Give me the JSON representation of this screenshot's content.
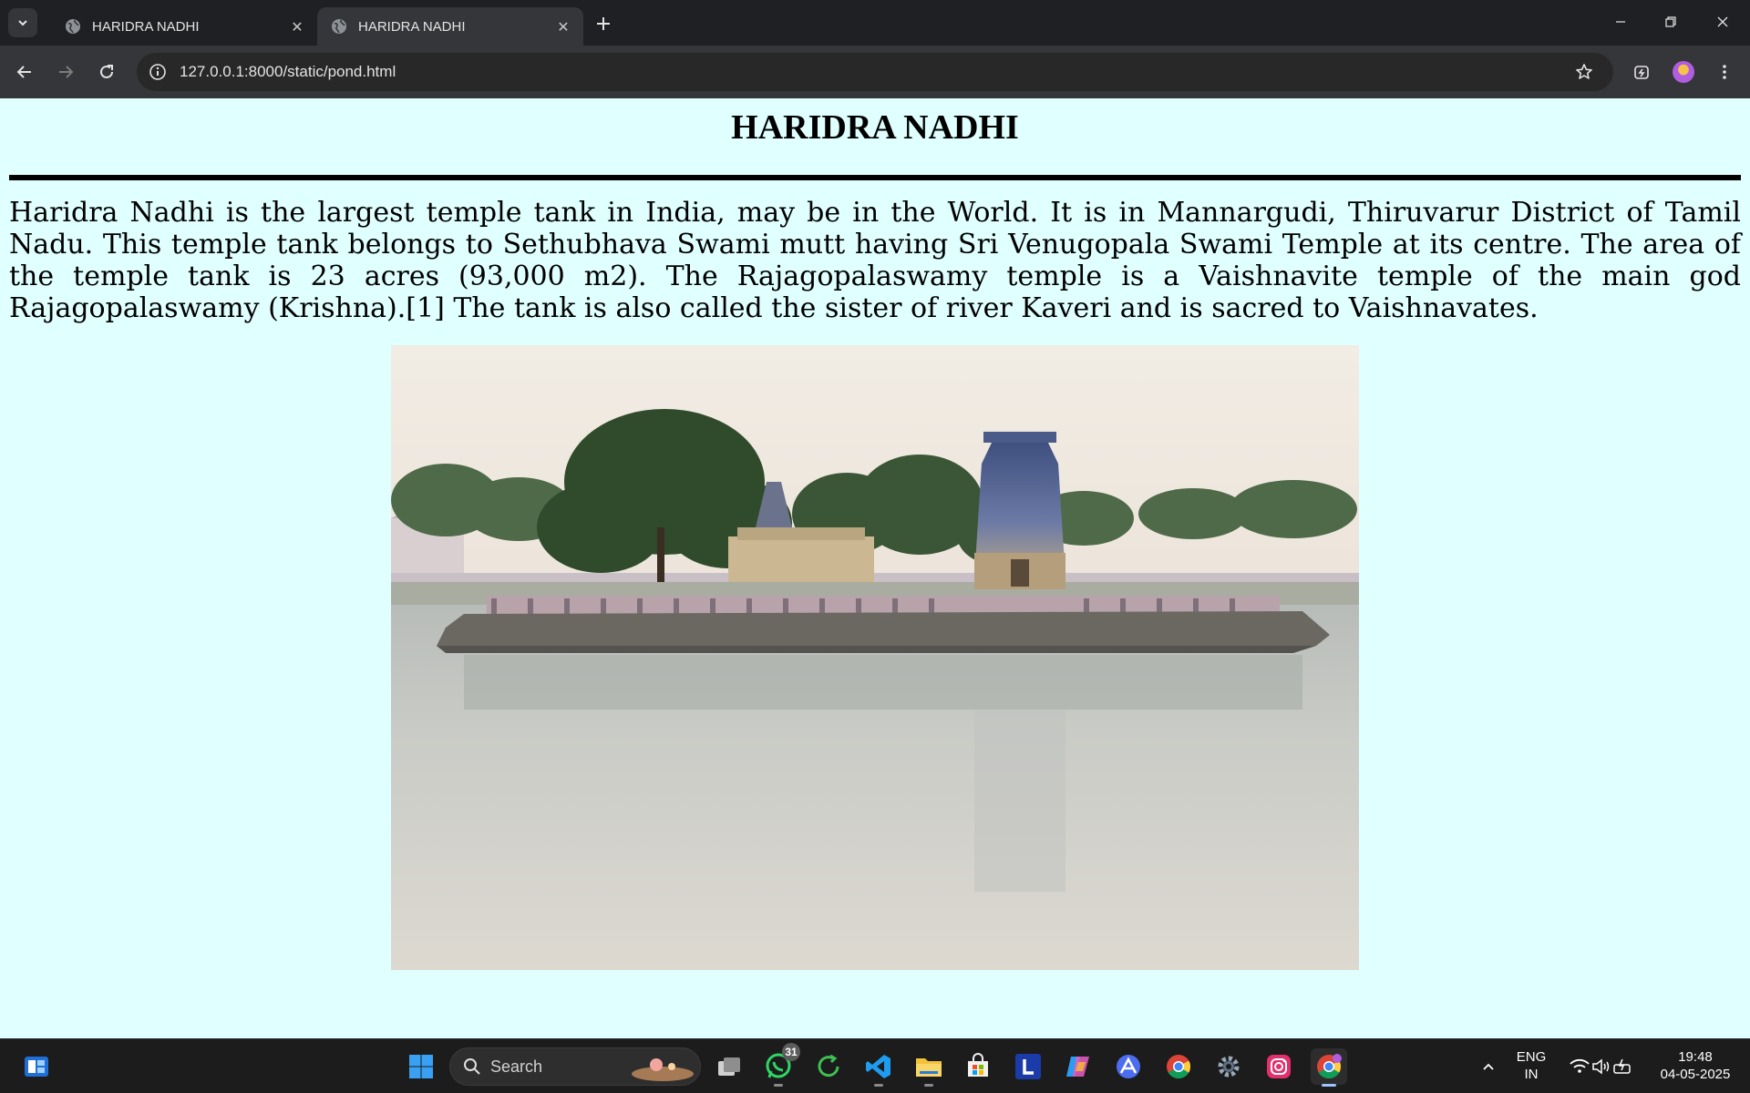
{
  "browser": {
    "tabs": [
      {
        "title": "HARIDRA NADHI",
        "active": false
      },
      {
        "title": "HARIDRA NADHI",
        "active": true
      }
    ],
    "address_bar": {
      "url": "127.0.0.1:8000/static/pond.html"
    },
    "icons": {
      "tab_search": "chevron-down-icon",
      "favicon": "globe-icon",
      "close": "close-icon",
      "new_tab": "plus-icon",
      "back": "arrow-left-icon",
      "forward": "arrow-right-icon",
      "reload": "reload-icon",
      "site_info": "info-icon",
      "bookmark": "star-icon",
      "extensions": "extension-icon",
      "menu": "kebab-menu-icon"
    }
  },
  "page": {
    "title": "HARIDRA NADHI",
    "intro": "Haridra Nadhi is the largest temple tank in India, may be in the World. It is in Mannargudi, Thiruvarur District of Tamil Nadu. This temple tank belongs to Sethubhava Swami mutt having Sri Venugopala Swami Temple at its centre. The area of the temple tank is 23 acres (93,000 m2). The Rajagopalaswamy temple is a Vaishnavite temple of the main god Rajagopalaswamy (Krishna).[1] The tank is also called the sister of river Kaveri and is sacred to Vaishnavates.",
    "background_color": "#e0ffff"
  },
  "taskbar": {
    "search_label": "Search",
    "whatsapp_badge": "31",
    "apps": [
      "widgets",
      "start",
      "search",
      "task-view",
      "whatsapp",
      "refresh-app",
      "vscode",
      "file-explorer",
      "microsoft-store",
      "l-app",
      "copilot",
      "arc-app",
      "chrome",
      "settings",
      "instagram",
      "chrome-profile"
    ],
    "tray": {
      "language_line1": "ENG",
      "language_line2": "IN",
      "time": "19:48",
      "date": "04-05-2025"
    }
  }
}
